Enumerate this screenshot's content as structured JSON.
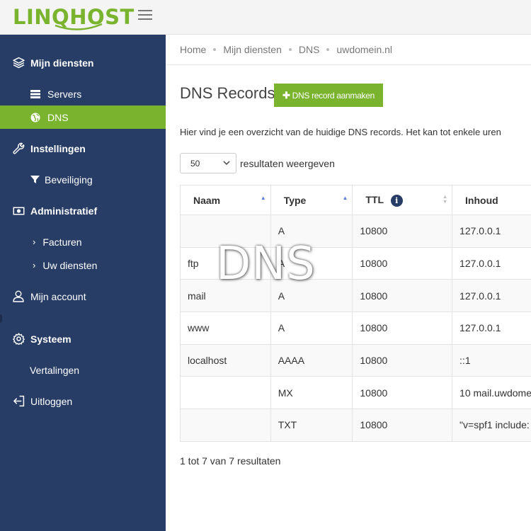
{
  "brand": {
    "logo_text": "LINQHOST",
    "accent": "#7ab32e",
    "sidebar_bg": "#273d66"
  },
  "sidebar": {
    "items": [
      {
        "label": "Mijn diensten",
        "icon": "layers-icon",
        "type": "heading"
      },
      {
        "label": "Servers",
        "icon": "server-icon",
        "type": "sub"
      },
      {
        "label": "DNS",
        "icon": "globe-icon",
        "type": "sub",
        "active": true
      },
      {
        "label": "Instellingen",
        "icon": "wrench-icon",
        "type": "heading"
      },
      {
        "label": "Beveiliging",
        "icon": "filter-icon",
        "type": "sub"
      },
      {
        "label": "Administratief",
        "icon": "money-icon",
        "type": "heading"
      },
      {
        "label": "Facturen",
        "icon": "chevron-right-icon",
        "type": "sub"
      },
      {
        "label": "Uw diensten",
        "icon": "chevron-right-icon",
        "type": "sub"
      },
      {
        "label": "Mijn account",
        "icon": "user-icon",
        "type": "item"
      },
      {
        "label": "Systeem",
        "icon": "gear-icon",
        "type": "heading"
      },
      {
        "label": "Vertalingen",
        "icon": "",
        "type": "item"
      },
      {
        "label": "Uitloggen",
        "icon": "logout-icon",
        "type": "item"
      }
    ]
  },
  "breadcrumb": [
    "Home",
    "Mijn diensten",
    "DNS",
    "uwdomein.nl"
  ],
  "page": {
    "title": "DNS Records",
    "add_button": "DNS record aanmaken",
    "intro": "Hier vind je een overzicht van de huidige DNS records. Het kan tot enkele uren",
    "length_value": "50",
    "length_suffix": "resultaten weergeven",
    "info": "1 tot 7 van 7 resultaten"
  },
  "table": {
    "columns": [
      "Naam",
      "Type",
      "TTL",
      "Inhoud"
    ],
    "rows": [
      {
        "naam": "",
        "type": "A",
        "ttl": "10800",
        "inhoud": "127.0.0.1"
      },
      {
        "naam": "ftp",
        "type": "A",
        "ttl": "10800",
        "inhoud": "127.0.0.1"
      },
      {
        "naam": "mail",
        "type": "A",
        "ttl": "10800",
        "inhoud": "127.0.0.1"
      },
      {
        "naam": "www",
        "type": "A",
        "ttl": "10800",
        "inhoud": "127.0.0.1"
      },
      {
        "naam": "localhost",
        "type": "AAAA",
        "ttl": "10800",
        "inhoud": "::1"
      },
      {
        "naam": "",
        "type": "MX",
        "ttl": "10800",
        "inhoud": "10 mail.uwdome"
      },
      {
        "naam": "",
        "type": "TXT",
        "ttl": "10800",
        "inhoud": "\"v=spf1 include:"
      }
    ]
  },
  "watermark": "DNS"
}
